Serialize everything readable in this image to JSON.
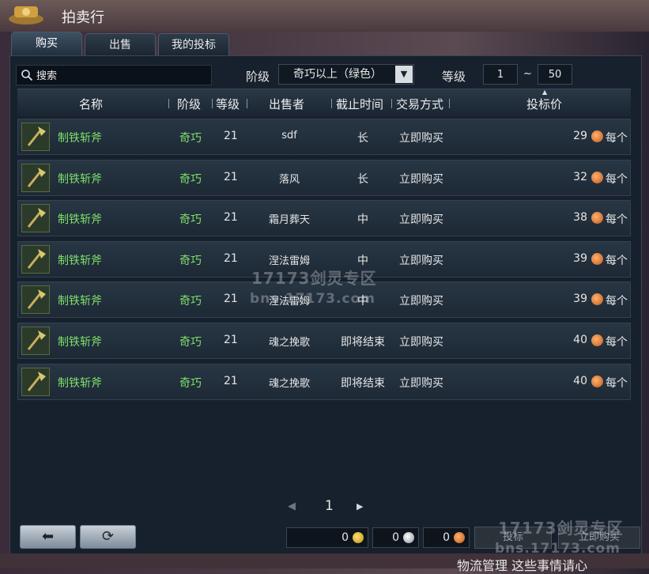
{
  "window": {
    "title": "拍卖行"
  },
  "tabs": [
    {
      "label": "购买",
      "active": true
    },
    {
      "label": "出售",
      "active": false
    },
    {
      "label": "我的投标",
      "active": false
    }
  ],
  "filters": {
    "search_placeholder": "搜索",
    "grade_label": "阶级",
    "grade_value": "奇巧以上（绿色）",
    "level_label": "等级",
    "level_min": "1",
    "level_sep": "~",
    "level_max": "50"
  },
  "columns": {
    "name": "名称",
    "grade": "阶级",
    "level": "等级",
    "seller": "出售者",
    "deadline": "截止时间",
    "trade": "交易方式",
    "price": "投标价"
  },
  "rows": [
    {
      "name": "制铁斩斧",
      "grade": "奇巧",
      "level": "21",
      "seller": "sdf",
      "deadline": "长",
      "trade": "立即购买",
      "price": "29",
      "unit": "每个"
    },
    {
      "name": "制铁斩斧",
      "grade": "奇巧",
      "level": "21",
      "seller": "落风",
      "deadline": "长",
      "trade": "立即购买",
      "price": "32",
      "unit": "每个"
    },
    {
      "name": "制铁斩斧",
      "grade": "奇巧",
      "level": "21",
      "seller": "霜月葬天",
      "deadline": "中",
      "trade": "立即购买",
      "price": "38",
      "unit": "每个"
    },
    {
      "name": "制铁斩斧",
      "grade": "奇巧",
      "level": "21",
      "seller": "涅法雷姆",
      "deadline": "中",
      "trade": "立即购买",
      "price": "39",
      "unit": "每个"
    },
    {
      "name": "制铁斩斧",
      "grade": "奇巧",
      "level": "21",
      "seller": "涅法雷姆",
      "deadline": "中",
      "trade": "立即购买",
      "price": "39",
      "unit": "每个"
    },
    {
      "name": "制铁斩斧",
      "grade": "奇巧",
      "level": "21",
      "seller": "魂之挽歌",
      "deadline": "即将结束",
      "trade": "立即购买",
      "price": "40",
      "unit": "每个"
    },
    {
      "name": "制铁斩斧",
      "grade": "奇巧",
      "level": "21",
      "seller": "魂之挽歌",
      "deadline": "即将结束",
      "trade": "立即购买",
      "price": "40",
      "unit": "每个"
    }
  ],
  "pagination": {
    "page": "1"
  },
  "footer": {
    "money_gold": "0",
    "money_silver": "0",
    "money_copper": "0",
    "bid_label": "投标",
    "buy_now_label": "立即购买"
  },
  "watermark": {
    "a": "17173剑灵专区",
    "b": "bns.17173.com"
  },
  "bottom_text": "物流管理  这些事情请心",
  "colors": {
    "green_text": "#7ee06a",
    "panel_bg": "#17212d"
  }
}
